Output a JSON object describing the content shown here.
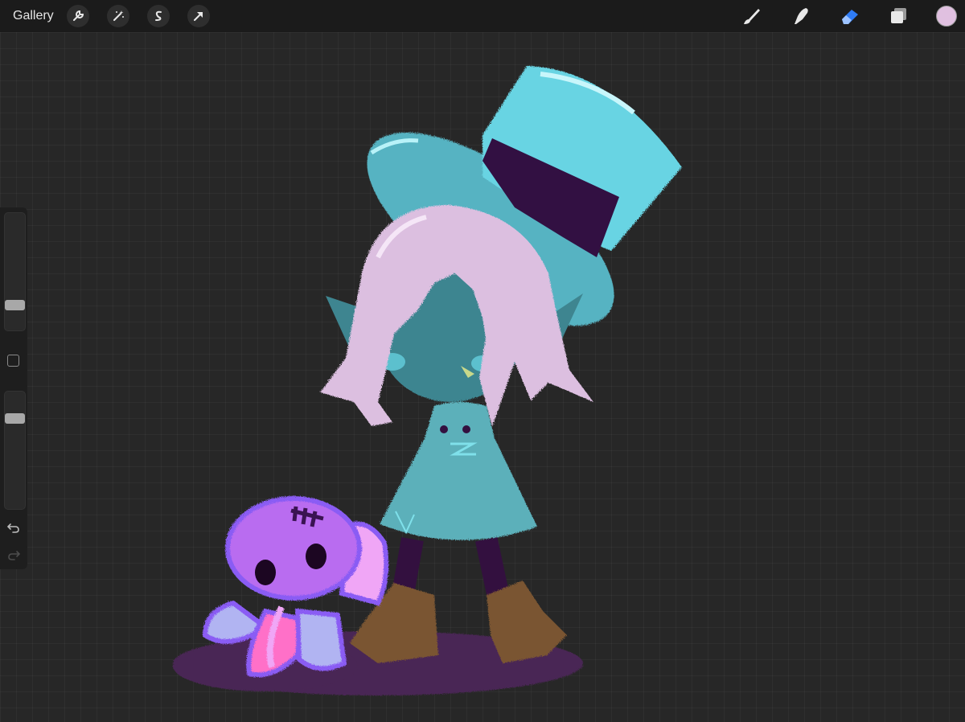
{
  "topbar": {
    "gallery_label": "Gallery",
    "left_tools": [
      "wrench-icon",
      "magic-wand-icon",
      "selection-icon",
      "transform-arrow-icon"
    ],
    "right_tools": [
      "brush-icon",
      "smudge-icon",
      "eraser-icon",
      "layers-icon"
    ],
    "active_tool": "eraser",
    "current_color": "#e0c0e0"
  },
  "sidebar": {
    "brush_size_level": 0.2,
    "opacity_level": 0.78,
    "tools": [
      "brush-size-slider",
      "modify-square",
      "opacity-slider",
      "undo-icon",
      "redo-icon"
    ]
  },
  "colors": {
    "accent_blue": "#2f7cf6",
    "hat": "#5fcbdc",
    "hat_band": "#321042",
    "hair": "#dcbfe0",
    "skin": "#3e8590",
    "dress": "#5bb0ba",
    "boots": "#7a5530",
    "shadow": "#4a2654",
    "octopus": "#b96cf0",
    "octopus_outline": "#8a5cf4",
    "tentacle_pink": "#ff70c8"
  }
}
